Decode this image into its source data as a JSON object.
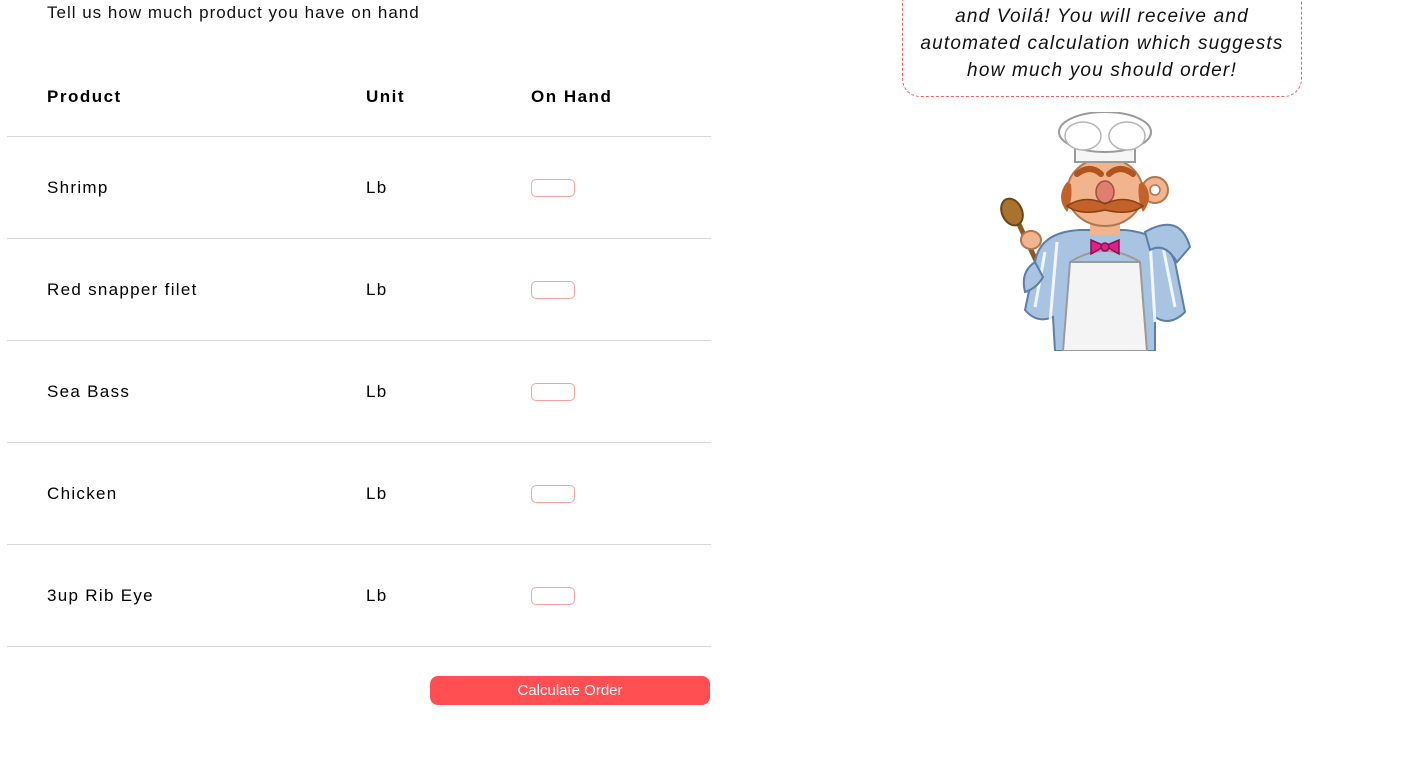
{
  "intro_text": "Tell us how much product you have on hand",
  "table": {
    "headers": {
      "product": "Product",
      "unit": "Unit",
      "on_hand": "On Hand"
    },
    "rows": [
      {
        "product": "Shrimp",
        "unit": "Lb",
        "on_hand": ""
      },
      {
        "product": "Red snapper filet",
        "unit": "Lb",
        "on_hand": ""
      },
      {
        "product": "Sea Bass",
        "unit": "Lb",
        "on_hand": ""
      },
      {
        "product": "Chicken",
        "unit": "Lb",
        "on_hand": ""
      },
      {
        "product": "3up Rib Eye",
        "unit": "Lb",
        "on_hand": ""
      }
    ]
  },
  "calculate_button_label": "Calculate Order",
  "bubble": {
    "lines": [
      "and Voilá! You will receive and",
      "automated calculation which suggests",
      "how much you should order!"
    ]
  },
  "illustration": {
    "icon": "swedish-chef-illustration"
  },
  "colors": {
    "accent": "#ff4f52",
    "input_border": "#f7a3a3",
    "bubble_border": "#f06060",
    "row_divider": "#d6d6d6"
  }
}
